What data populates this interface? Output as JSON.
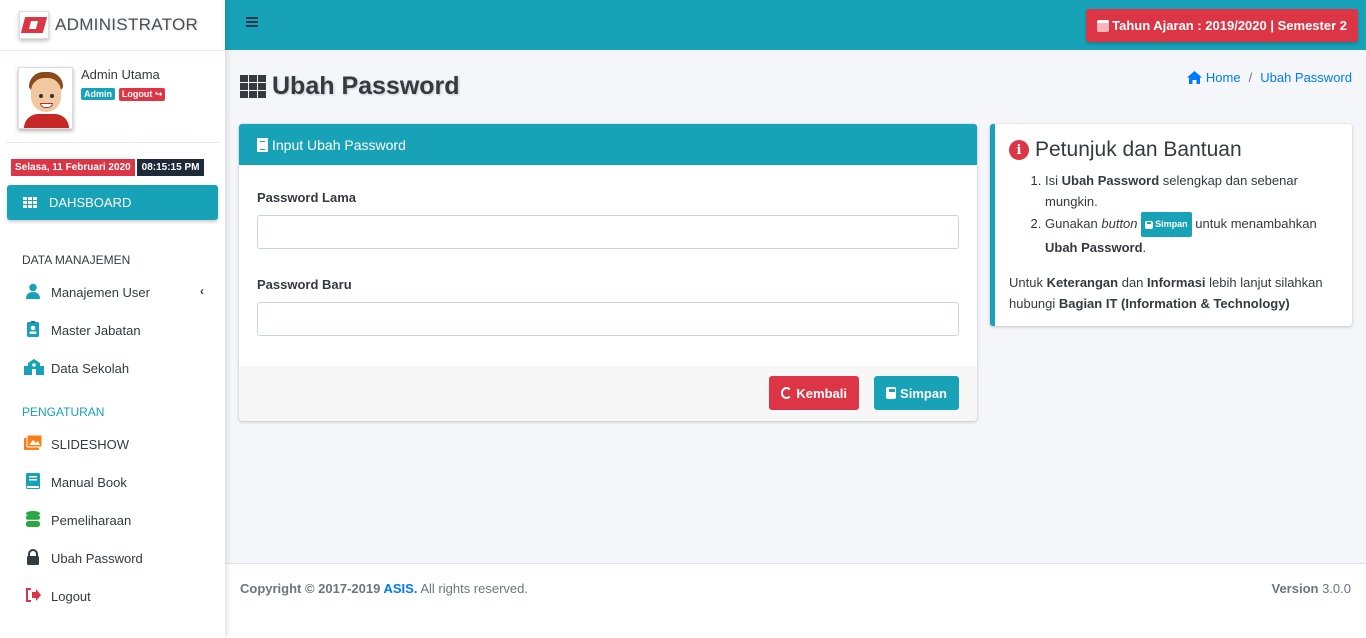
{
  "brand": {
    "name": "ADMINISTRATOR"
  },
  "user": {
    "name": "Admin Utama",
    "role_badge": "Admin",
    "logout_badge": "Logout"
  },
  "datetime": {
    "date": "Selasa, 11 Februari 2020",
    "time": "08:15:15 PM"
  },
  "sidebar": {
    "dashboard": "DAHSBOARD",
    "section_data": "DATA MANAJEMEN",
    "section_settings": "PENGATURAN",
    "items": [
      {
        "label": "Manajemen User",
        "icon": "user-icon",
        "color": "#17a2b8"
      },
      {
        "label": "Master Jabatan",
        "icon": "id-badge-icon",
        "color": "#17a2b8"
      },
      {
        "label": "Data Sekolah",
        "icon": "school-icon",
        "color": "#17a2b8"
      },
      {
        "label": "SLIDESHOW",
        "icon": "images-icon",
        "color": "#fd7e14"
      },
      {
        "label": "Manual Book",
        "icon": "book-icon",
        "color": "#17a2b8"
      },
      {
        "label": "Pemeliharaan",
        "icon": "database-icon",
        "color": "#28a745"
      },
      {
        "label": "Ubah Password",
        "icon": "lock-icon",
        "color": "#343a40"
      },
      {
        "label": "Logout",
        "icon": "sign-out-icon",
        "color": "#dc3545"
      }
    ]
  },
  "topbar": {
    "academic_year": "Tahun Ajaran : 2019/2020 | Semester 2"
  },
  "page": {
    "title": "Ubah Password"
  },
  "breadcrumb": {
    "home": "Home",
    "current": "Ubah Password"
  },
  "form": {
    "header": "Input Ubah Password",
    "old_password_label": "Password Lama",
    "new_password_label": "Password Baru",
    "old_password_value": "",
    "new_password_value": "",
    "back_button": "Kembali",
    "save_button": "Simpan"
  },
  "help": {
    "title": "Petunjuk dan Bantuan",
    "step1_a": "Isi ",
    "step1_b": "Ubah Password",
    "step1_c": " selengkap dan sebenar mungkin.",
    "step2_a": "Gunakan ",
    "step2_b": "button",
    "step2_btn": "Simpan",
    "step2_c": " untuk menambahkan ",
    "step2_d": "Ubah Password",
    "step2_e": ".",
    "note_a": "Untuk ",
    "note_b": "Keterangan",
    "note_c": " dan ",
    "note_d": "Informasi",
    "note_e": " lebih lanjut silahkan hubungi ",
    "note_f": "Bagian IT (Information & Technology)"
  },
  "footer": {
    "copyright": "Copyright © 2017-2019 ",
    "brand": "ASIS.",
    "rights": " All rights reserved.",
    "version_label": "Version",
    "version": " 3.0.0"
  },
  "colors": {
    "primary": "#17a2b8",
    "danger": "#dc3545",
    "dark": "#343a40"
  }
}
